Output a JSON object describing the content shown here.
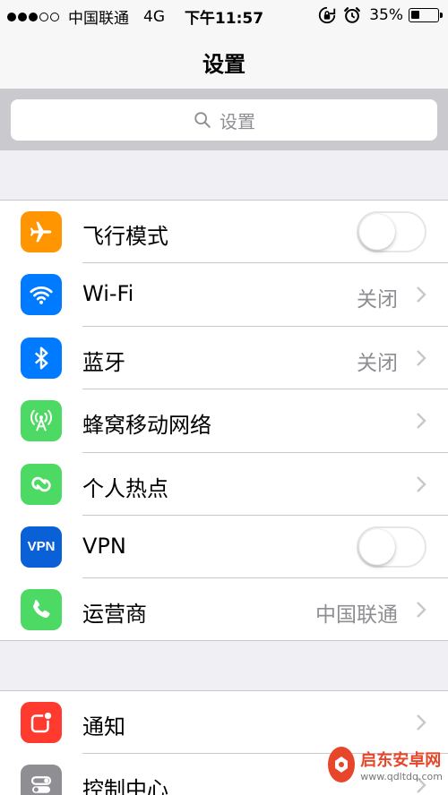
{
  "status_bar": {
    "signal_dots_filled": 3,
    "signal_dots_total": 5,
    "carrier": "中国联通",
    "network": "4G",
    "time": "下午11:57",
    "battery_percent": "35%",
    "battery_level": 0.35
  },
  "nav": {
    "title": "设置"
  },
  "search": {
    "placeholder": "设置"
  },
  "group1": [
    {
      "label": "飞行模式",
      "control": "toggle",
      "on": false,
      "icon": "airplane-icon",
      "color": "#ff9500"
    },
    {
      "label": "Wi-Fi",
      "value": "关闭",
      "control": "chevron",
      "icon": "wifi-icon",
      "color": "#007aff"
    },
    {
      "label": "蓝牙",
      "value": "关闭",
      "control": "chevron",
      "icon": "bluetooth-icon",
      "color": "#007aff"
    },
    {
      "label": "蜂窝移动网络",
      "control": "chevron",
      "icon": "cellular-icon",
      "color": "#4cd964"
    },
    {
      "label": "个人热点",
      "control": "chevron",
      "icon": "hotspot-icon",
      "color": "#4cd964"
    },
    {
      "label": "VPN",
      "control": "toggle",
      "on": false,
      "icon": "vpn-icon",
      "icon_text": "VPN",
      "color": "#0a60d6"
    },
    {
      "label": "运营商",
      "value": "中国联通",
      "control": "chevron",
      "icon": "phone-icon",
      "color": "#4cd964"
    }
  ],
  "group2": [
    {
      "label": "通知",
      "control": "chevron",
      "icon": "notifications-icon",
      "color": "#ff3b30"
    },
    {
      "label": "控制中心",
      "control": "chevron",
      "icon": "control-center-icon",
      "color": "#8e8e93"
    }
  ],
  "watermark": {
    "title": "启东安卓网",
    "url": "www.qdltdq.com"
  }
}
